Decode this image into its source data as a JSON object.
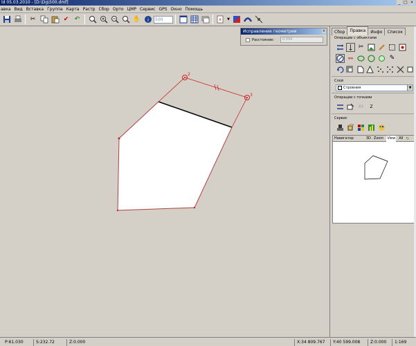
{
  "window": {
    "title": "ld 05.03.2010 - [D:\\Dg\\500.dmf]"
  },
  "menu": [
    "авка",
    "Вид",
    "Вставка",
    "Группа",
    "Карта",
    "Растр",
    "Сбор",
    "Орто",
    "ЦМР",
    "Сервис",
    "GPS",
    "Окно",
    "Помощь"
  ],
  "toolbar": {
    "scale_value": "500"
  },
  "geometry_dialog": {
    "title": "Исправление геометрии",
    "distance_label": "Расстояние:",
    "distance_value": "0.094"
  },
  "panel": {
    "tabs": [
      "Сбор",
      "Правка",
      "Инфо",
      "Список"
    ],
    "active_tab": "Правка",
    "objects_title": "Операции с объектами",
    "layer_title": "Слой",
    "layer_value": "Строения",
    "points_title": "Операции с точками",
    "points_labels": [
      "XY",
      "Z"
    ],
    "service_title": "Сервис"
  },
  "navigator": {
    "title": "Навигатор",
    "tabs": [
      "3D",
      "Zoom",
      "View",
      "All"
    ]
  },
  "drawing": {
    "vertex_labels": [
      "2",
      "3"
    ]
  },
  "status": {
    "p": "P:61.030",
    "s": "S:232.72",
    "z1": "Z:0.000",
    "x": "X:34 809.767",
    "y": "Y:40 599.008",
    "z2": "Z:0.000",
    "scale": "1:169"
  },
  "colors": {
    "title_start": "#0a246a",
    "title_end": "#a6caf0",
    "edit_line": "#cc2222",
    "polygon_fill": "#ffffff"
  }
}
